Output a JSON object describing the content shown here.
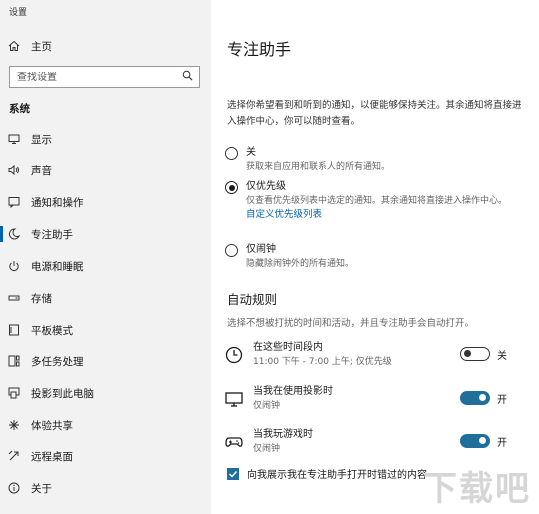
{
  "window": {
    "title": "设置"
  },
  "sidebar": {
    "home_label": "主页",
    "search": {
      "placeholder": "查找设置"
    },
    "section_label": "系统",
    "items": [
      {
        "label": "显示",
        "icon": "display-icon"
      },
      {
        "label": "声音",
        "icon": "speaker-icon"
      },
      {
        "label": "通知和操作",
        "icon": "notification-icon"
      },
      {
        "label": "专注助手",
        "icon": "moon-icon",
        "active": true
      },
      {
        "label": "电源和睡眠",
        "icon": "power-icon"
      },
      {
        "label": "存储",
        "icon": "storage-icon"
      },
      {
        "label": "平板模式",
        "icon": "tablet-icon"
      },
      {
        "label": "多任务处理",
        "icon": "multitask-icon"
      },
      {
        "label": "投影到此电脑",
        "icon": "project-icon"
      },
      {
        "label": "体验共享",
        "icon": "share-icon"
      },
      {
        "label": "远程桌面",
        "icon": "remote-icon"
      },
      {
        "label": "关于",
        "icon": "info-icon"
      }
    ]
  },
  "main": {
    "title": "专注助手",
    "intro": "选择你希望看到和听到的通知，以便能够保持关注。其余通知将直接进入操作中心，你可以随时查看。",
    "options": [
      {
        "title": "关",
        "desc": "获取来自应用和联系人的所有通知。",
        "checked": false
      },
      {
        "title": "仅优先级",
        "desc": "仅查看优先级列表中选定的通知。其余通知将直接进入操作中心。",
        "link": "自定义优先级列表",
        "checked": true
      },
      {
        "title": "仅闹钟",
        "desc": "隐藏除闹钟外的所有通知。",
        "checked": false
      }
    ],
    "auto_rules": {
      "heading": "自动规则",
      "subtitle": "选择不想被打扰的时间和活动，并且专注助手会自动打开。",
      "rules": [
        {
          "title": "在这些时间段内",
          "desc": "11:00 下午 - 7:00 上午; 仅优先级",
          "state_label": "关",
          "on": false,
          "icon": "clock-icon"
        },
        {
          "title": "当我在使用投影时",
          "desc": "仅闹钟",
          "state_label": "开",
          "on": true,
          "icon": "monitor-icon"
        },
        {
          "title": "当我玩游戏时",
          "desc": "仅闹钟",
          "state_label": "开",
          "on": true,
          "icon": "gamepad-icon"
        }
      ]
    },
    "summary_checkbox": {
      "label": "向我展示我在专注助手打开时错过的内容",
      "checked": true
    }
  },
  "watermark": "下载吧",
  "colors": {
    "accent": "#0063b1",
    "toggle_on": "#1f6f9a",
    "sidebar_bg": "#f2f2f2"
  }
}
